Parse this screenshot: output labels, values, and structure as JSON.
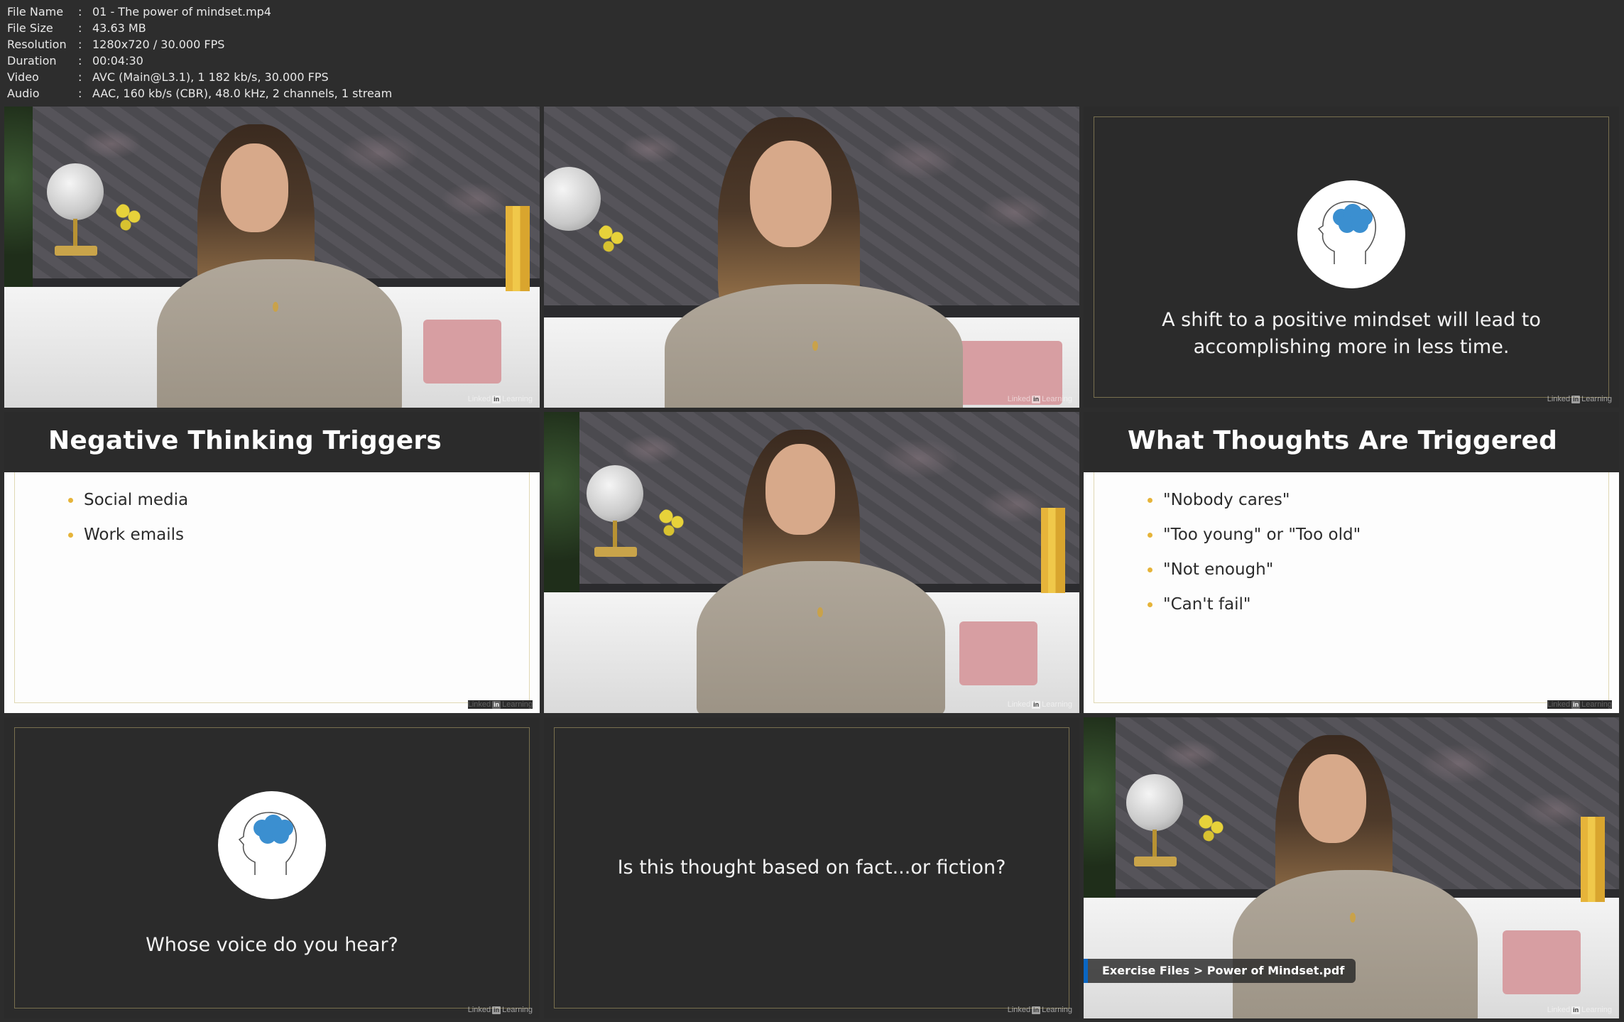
{
  "meta": {
    "rows": [
      {
        "key": "File Name",
        "value": "01 - The power of mindset.mp4"
      },
      {
        "key": "File Size",
        "value": "43.63 MB"
      },
      {
        "key": "Resolution",
        "value": "1280x720 / 30.000 FPS"
      },
      {
        "key": "Duration",
        "value": "00:04:30"
      },
      {
        "key": "Video",
        "value": "AVC (Main@L3.1), 1 182 kb/s, 30.000 FPS"
      },
      {
        "key": "Audio",
        "value": "AAC, 160 kb/s (CBR), 48.0 kHz, 2 channels, 1 stream"
      }
    ]
  },
  "watermark": {
    "brand_left": "Linked",
    "brand_in": "in",
    "brand_right": "Learning"
  },
  "slides": {
    "shift": {
      "text_line1": "A shift to a positive mindset will lead to",
      "text_line2": "accomplishing more in less time."
    },
    "negative": {
      "title": "Negative Thinking Triggers",
      "bullets": [
        "Social media",
        "Work emails"
      ]
    },
    "thoughts": {
      "title": "What Thoughts Are Triggered",
      "bullets": [
        "\"Nobody cares\"",
        "\"Too young\" or \"Too old\"",
        "\"Not enough\"",
        "\"Can't fail\""
      ]
    },
    "voice": {
      "text": "Whose voice do you hear?"
    },
    "fact": {
      "text": "Is this thought based on fact...or fiction?"
    },
    "caption": {
      "text": "Exercise Files > Power of Mindset.pdf"
    }
  },
  "colors": {
    "accent_bullet": "#e6b43a",
    "brain": "#3b8fd0",
    "caption_bar": "#0a66c2",
    "slide_dark": "#2b2b2b"
  }
}
